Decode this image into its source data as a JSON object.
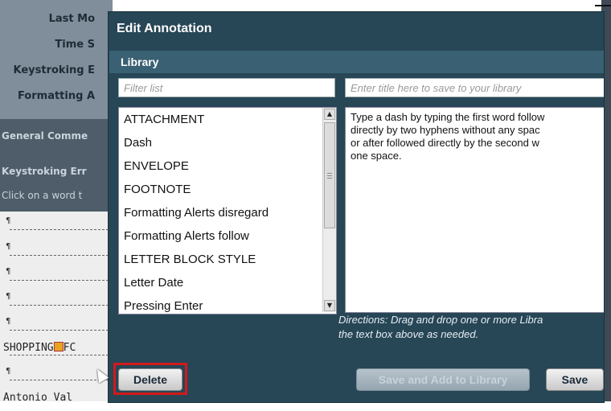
{
  "background": {
    "labels": [
      "Last Mo",
      "Time S",
      "Keystroking E",
      "Formatting A"
    ],
    "general_comments": "General Comme",
    "keystroking_errors": "Keystroking Err",
    "click_hint": "Click on a word t",
    "doc_lines": [
      "¶",
      "¶",
      "¶",
      "¶",
      "¶"
    ],
    "shopping_text_1": "SHOPPING",
    "shopping_text_2": "FC",
    "pilcrow_6": "¶",
    "name_text": "Antonio Val"
  },
  "dialog": {
    "title": "Edit Annotation",
    "library_title": "Library",
    "filter_placeholder": "Filter list",
    "title_placeholder": "Enter title here to save to your library",
    "library_items": [
      "ATTACHMENT",
      "Dash",
      "ENVELOPE",
      "FOOTNOTE",
      "Formatting Alerts disregard",
      "Formatting Alerts follow",
      "LETTER BLOCK STYLE",
      "Letter Date",
      "Pressing Enter"
    ],
    "content_lines": [
      "Type a dash by typing the first word follow",
      "directly by two hyphens without any spac",
      "or after followed directly by the second w",
      "one space."
    ],
    "directions_lines": [
      "Directions: Drag and drop one or more Libra",
      "the text box above as needed."
    ],
    "buttons": {
      "delete": "Delete",
      "save_add": "Save and Add to Library",
      "save": "Save"
    }
  },
  "colors": {
    "dialog_bg": "#274656",
    "library_bar": "#3a6073",
    "highlight": "#d11a1a"
  }
}
